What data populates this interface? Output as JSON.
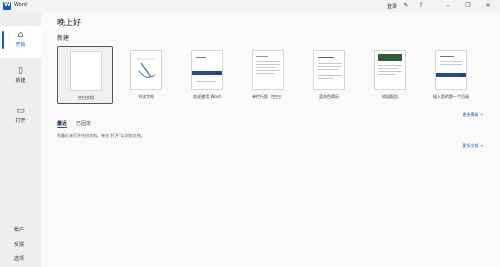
{
  "window": {
    "title": "Word",
    "signin_label": "登录",
    "icons": [
      "designer-icon",
      "help-icon",
      "minimize-icon",
      "restore-icon",
      "close-icon"
    ]
  },
  "sidebar": {
    "items": [
      {
        "label": "开始",
        "icon": "home-icon",
        "selected": true
      },
      {
        "label": "新建",
        "icon": "new-document-icon",
        "selected": false
      },
      {
        "label": "打开",
        "icon": "folder-icon",
        "selected": false
      }
    ],
    "bottom": {
      "account": "帐户",
      "feedback": "反馈",
      "options": "选项"
    }
  },
  "main": {
    "greeting": "晚上好",
    "new_heading": "新建",
    "templates": [
      {
        "label": "空白文档"
      },
      {
        "label": "书法字帖"
      },
      {
        "label": "欢迎使用 Word"
      },
      {
        "label": "单栏行距（空白）"
      },
      {
        "label": "蓝灰色简历"
      },
      {
        "label": "校园报告"
      },
      {
        "label": "插入您的第一个目录"
      }
    ],
    "more_templates": "更多模板 →",
    "tabs": {
      "recent": "最近",
      "pinned": "已固定"
    },
    "recent_empty": "你最近未打开任何文档。单击\"打开\"以浏览文档。",
    "more_documents": "更多文档 →"
  },
  "colors": {
    "accent": "#185abd",
    "brand_dark": "#2b4c8c"
  }
}
